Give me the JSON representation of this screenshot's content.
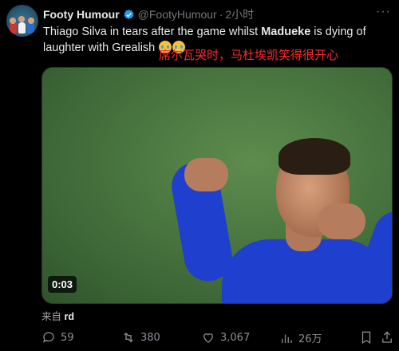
{
  "author": {
    "display_name": "Footy Humour",
    "handle": "@FootyHumour",
    "separator": "·",
    "time": "2小时"
  },
  "post": {
    "text_part1": "Thiago Silva in tears after the game whilst ",
    "text_bold": "Madueke",
    "text_part2": " is dying of laughter with Grealish ",
    "annotation_cn": "席尔瓦哭时，马杜埃凯笑得很开心"
  },
  "video": {
    "timecode": "0:03"
  },
  "source": {
    "label": "来自",
    "name": "rd"
  },
  "actions": {
    "replies": "59",
    "reposts": "380",
    "likes": "3,067",
    "views": "26万"
  },
  "colors": {
    "accent_verified": "#1d9bf0",
    "annotation": "#ff2a2a"
  }
}
